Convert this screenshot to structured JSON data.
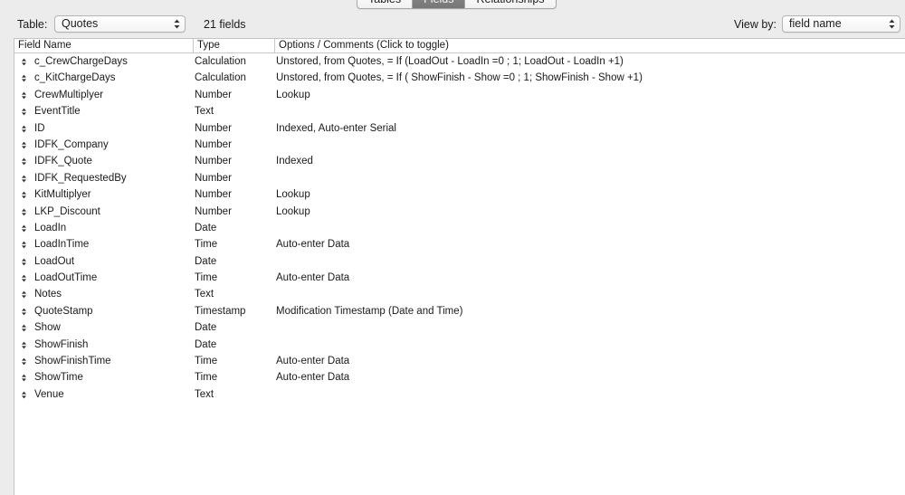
{
  "tabs": [
    {
      "label": "Tables",
      "active": false
    },
    {
      "label": "Fields",
      "active": true
    },
    {
      "label": "Relationships",
      "active": false
    }
  ],
  "toolbar": {
    "table_label": "Table:",
    "table_value": "Quotes",
    "field_count": "21 fields",
    "view_label": "View by:",
    "view_value": "field name"
  },
  "columns": {
    "name": "Field Name",
    "type": "Type",
    "options": "Options / Comments   (Click to toggle)"
  },
  "fields": [
    {
      "name": "c_CrewChargeDays",
      "type": "Calculation",
      "options": "Unstored, from Quotes, =  If (LoadOut - LoadIn =0 ; 1; LoadOut - LoadIn +1)"
    },
    {
      "name": "c_KitChargeDays",
      "type": "Calculation",
      "options": "Unstored, from Quotes, =  If ( ShowFinish - Show =0 ; 1; ShowFinish - Show +1)"
    },
    {
      "name": "CrewMultiplyer",
      "type": "Number",
      "options": "Lookup"
    },
    {
      "name": "EventTitle",
      "type": "Text",
      "options": ""
    },
    {
      "name": "ID",
      "type": "Number",
      "options": "Indexed, Auto-enter Serial"
    },
    {
      "name": "IDFK_Company",
      "type": "Number",
      "options": ""
    },
    {
      "name": "IDFK_Quote",
      "type": "Number",
      "options": "Indexed"
    },
    {
      "name": "IDFK_RequestedBy",
      "type": "Number",
      "options": ""
    },
    {
      "name": "KitMultiplyer",
      "type": "Number",
      "options": "Lookup"
    },
    {
      "name": "LKP_Discount",
      "type": "Number",
      "options": "Lookup"
    },
    {
      "name": "LoadIn",
      "type": "Date",
      "options": ""
    },
    {
      "name": "LoadInTime",
      "type": "Time",
      "options": "Auto-enter Data"
    },
    {
      "name": "LoadOut",
      "type": "Date",
      "options": ""
    },
    {
      "name": "LoadOutTime",
      "type": "Time",
      "options": "Auto-enter Data"
    },
    {
      "name": "Notes",
      "type": "Text",
      "options": ""
    },
    {
      "name": "QuoteStamp",
      "type": "Timestamp",
      "options": "Modification Timestamp (Date and Time)"
    },
    {
      "name": "Show",
      "type": "Date",
      "options": ""
    },
    {
      "name": "ShowFinish",
      "type": "Date",
      "options": ""
    },
    {
      "name": "ShowFinishTime",
      "type": "Time",
      "options": "Auto-enter Data"
    },
    {
      "name": "ShowTime",
      "type": "Time",
      "options": "Auto-enter Data"
    },
    {
      "name": "Venue",
      "type": "Text",
      "options": ""
    }
  ],
  "icons": {
    "row_handle": "drag-handle-icon",
    "select_arrows": "up-down-arrows-icon"
  },
  "colors": {
    "active_tab": "#7d7d7d",
    "window_bg": "#ececec",
    "table_bg": "#ffffff"
  }
}
